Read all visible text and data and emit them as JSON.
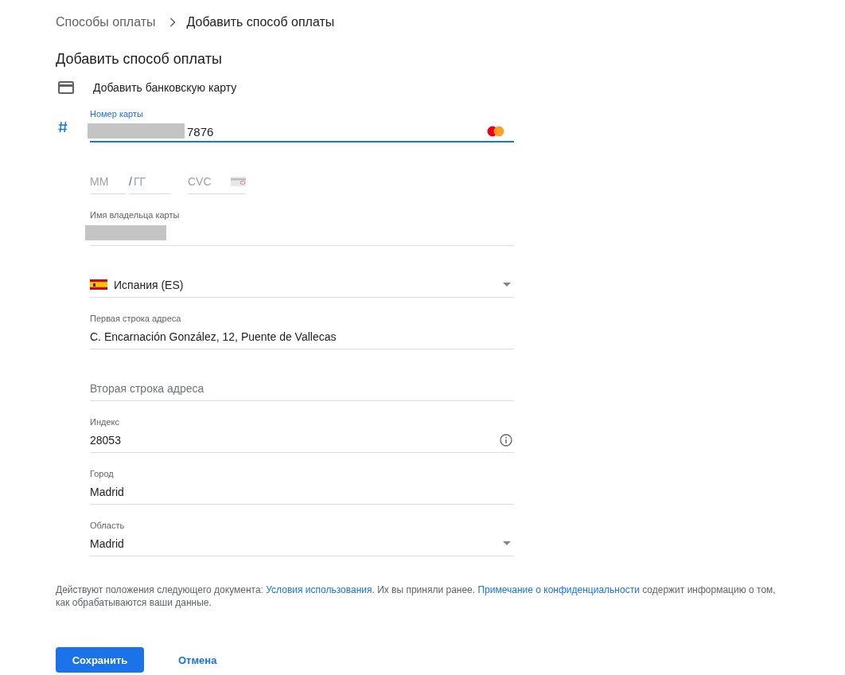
{
  "breadcrumb": {
    "parent": "Способы оплаты",
    "current": "Добавить способ оплаты"
  },
  "title": "Добавить способ оплаты",
  "method": {
    "label": "Добавить банковскую карту"
  },
  "card_number": {
    "label": "Номер карты",
    "value": "7876",
    "redacted": true,
    "focused": true
  },
  "expiry": {
    "month_placeholder": "ММ",
    "separator": "/",
    "year_placeholder": "ГГ",
    "cvc_placeholder": "CVC"
  },
  "fields": [
    {
      "kind": "text",
      "label": "Имя владельца карты",
      "redacted": true
    },
    {
      "kind": "select",
      "value": "Испания (ES)",
      "flag": true
    },
    {
      "kind": "text",
      "label": "Первая строка адреса",
      "value": "C. Encarnación González, 12, Puente de Vallecas"
    },
    {
      "kind": "text",
      "placeholder": "Вторая строка адреса"
    },
    {
      "kind": "text",
      "label": "Индекс",
      "value": "28053",
      "info": true
    },
    {
      "kind": "text",
      "label": "Город",
      "value": "Madrid"
    },
    {
      "kind": "select",
      "label": "Область",
      "value": "Madrid"
    }
  ],
  "legal": [
    {
      "kind": "text",
      "text": "Действуют положения следующего документа: "
    },
    {
      "kind": "link",
      "text": "Условия использования"
    },
    {
      "kind": "text",
      "text": ". Их вы приняли ранее. "
    },
    {
      "kind": "link",
      "text": "Примечание о конфиденциальности"
    },
    {
      "kind": "text",
      "text": " содержит информацию о том, как обрабатываются ваши данные."
    }
  ],
  "buttons": [
    {
      "kind": "primary",
      "label": "Сохранить"
    },
    {
      "kind": "text",
      "label": "Отмена"
    }
  ]
}
